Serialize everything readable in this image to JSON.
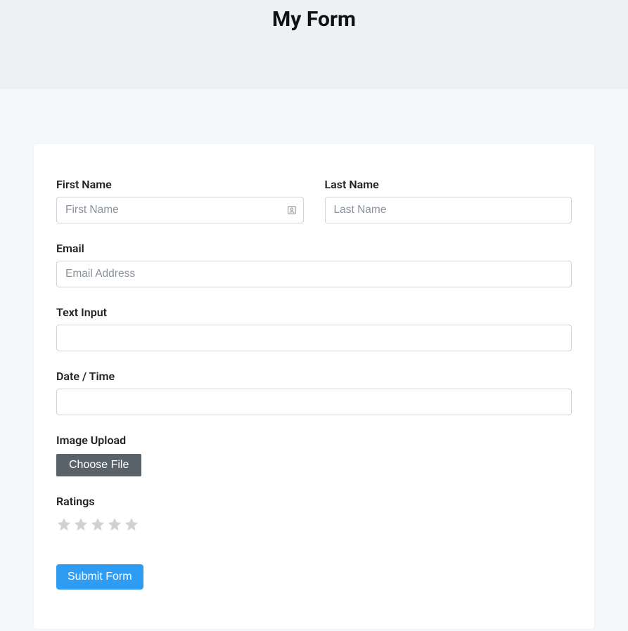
{
  "header": {
    "title": "My Form"
  },
  "form": {
    "first_name": {
      "label": "First Name",
      "placeholder": "First Name",
      "value": ""
    },
    "last_name": {
      "label": "Last Name",
      "placeholder": "Last Name",
      "value": ""
    },
    "email": {
      "label": "Email",
      "placeholder": "Email Address",
      "value": ""
    },
    "text_input": {
      "label": "Text Input",
      "value": ""
    },
    "date_time": {
      "label": "Date / Time",
      "value": ""
    },
    "image_upload": {
      "label": "Image Upload",
      "button_label": "Choose File"
    },
    "ratings": {
      "label": "Ratings",
      "value": 0,
      "max": 5
    },
    "submit": {
      "label": "Submit Form"
    }
  }
}
